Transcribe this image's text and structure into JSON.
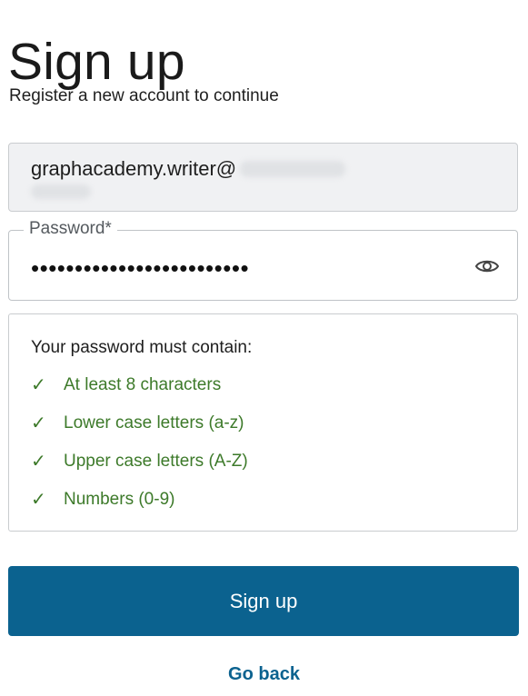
{
  "header": {
    "title": "Sign up",
    "subtitle": "Register a new account to continue"
  },
  "email_field": {
    "value": "graphacademy.writer@"
  },
  "password_field": {
    "label": "Password*",
    "masked_value": "•••••••••••••••••••••••••",
    "toggle_icon": "eye-icon"
  },
  "requirements": {
    "heading": "Your password must contain:",
    "check_glyph": "✓",
    "items": [
      {
        "label": "At least 8 characters",
        "met": true
      },
      {
        "label": "Lower case letters (a-z)",
        "met": true
      },
      {
        "label": "Upper case letters (A-Z)",
        "met": true
      },
      {
        "label": "Numbers (0-9)",
        "met": true
      }
    ]
  },
  "actions": {
    "submit_label": "Sign up",
    "back_label": "Go back"
  },
  "colors": {
    "primary": "#0b628f",
    "success": "#3d7a2a",
    "field_bg": "#f0f1f3"
  }
}
